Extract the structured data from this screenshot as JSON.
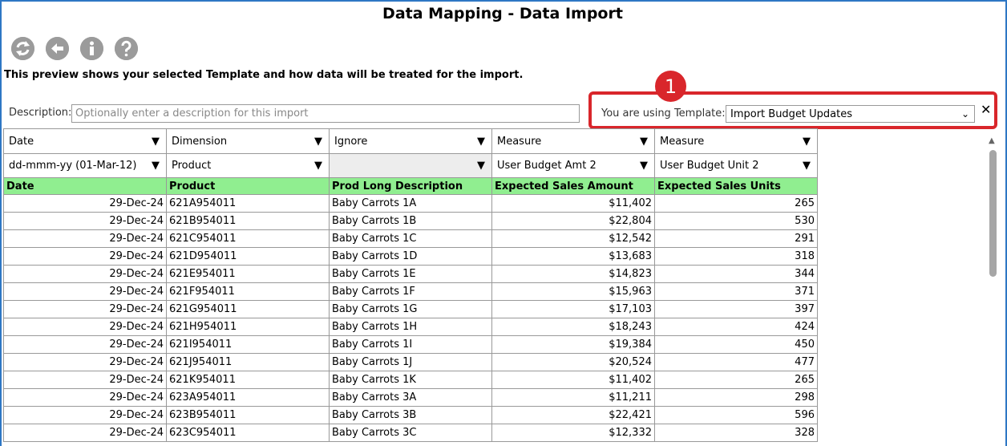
{
  "title": "Data Mapping - Data Import",
  "toolbar": {
    "refresh_icon": "refresh-icon",
    "back_icon": "back-arrow-icon",
    "info_icon": "info-icon",
    "help_icon": "help-icon"
  },
  "preview_text": "This preview shows your selected Template and how data will be treated for the import.",
  "description": {
    "label": "Description:",
    "placeholder": "Optionally enter a description for this import",
    "value": ""
  },
  "template": {
    "label": "You are using Template:",
    "selected": "Import Budget Updates",
    "close": "✕"
  },
  "badge": "1",
  "columns": [
    {
      "type": "Date",
      "mapping": "dd-mmm-yy (01-Mar-12)",
      "header": "Date"
    },
    {
      "type": "Dimension",
      "mapping": "Product",
      "header": "Product"
    },
    {
      "type": "Ignore",
      "mapping": "",
      "header": "Prod Long Description"
    },
    {
      "type": "Measure",
      "mapping": "User Budget Amt 2",
      "header": "Expected Sales Amount"
    },
    {
      "type": "Measure",
      "mapping": "User Budget Unit 2",
      "header": "Expected Sales Units"
    }
  ],
  "rows": [
    [
      "29-Dec-24",
      "621A954011",
      "Baby Carrots 1A",
      "$11,402",
      "265"
    ],
    [
      "29-Dec-24",
      "621B954011",
      "Baby Carrots 1B",
      "$22,804",
      "530"
    ],
    [
      "29-Dec-24",
      "621C954011",
      "Baby Carrots 1C",
      "$12,542",
      "291"
    ],
    [
      "29-Dec-24",
      "621D954011",
      "Baby Carrots 1D",
      "$13,683",
      "318"
    ],
    [
      "29-Dec-24",
      "621E954011",
      "Baby Carrots 1E",
      "$14,823",
      "344"
    ],
    [
      "29-Dec-24",
      "621F954011",
      "Baby Carrots 1F",
      "$15,963",
      "371"
    ],
    [
      "29-Dec-24",
      "621G954011",
      "Baby Carrots 1G",
      "$17,103",
      "397"
    ],
    [
      "29-Dec-24",
      "621H954011",
      "Baby Carrots 1H",
      "$18,243",
      "424"
    ],
    [
      "29-Dec-24",
      "621I954011",
      "Baby Carrots 1I",
      "$19,384",
      "450"
    ],
    [
      "29-Dec-24",
      "621J954011",
      "Baby Carrots 1J",
      "$20,524",
      "477"
    ],
    [
      "29-Dec-24",
      "621K954011",
      "Baby Carrots 1K",
      "$11,402",
      "265"
    ],
    [
      "29-Dec-24",
      "623A954011",
      "Baby Carrots 3A",
      "$11,211",
      "298"
    ],
    [
      "29-Dec-24",
      "623B954011",
      "Baby Carrots 3B",
      "$22,421",
      "596"
    ],
    [
      "29-Dec-24",
      "623C954011",
      "Baby Carrots 3C",
      "$12,332",
      "328"
    ]
  ],
  "colors": {
    "header_bg": "#90ee90",
    "highlight": "#d9262b",
    "frame": "#2e77c4"
  }
}
